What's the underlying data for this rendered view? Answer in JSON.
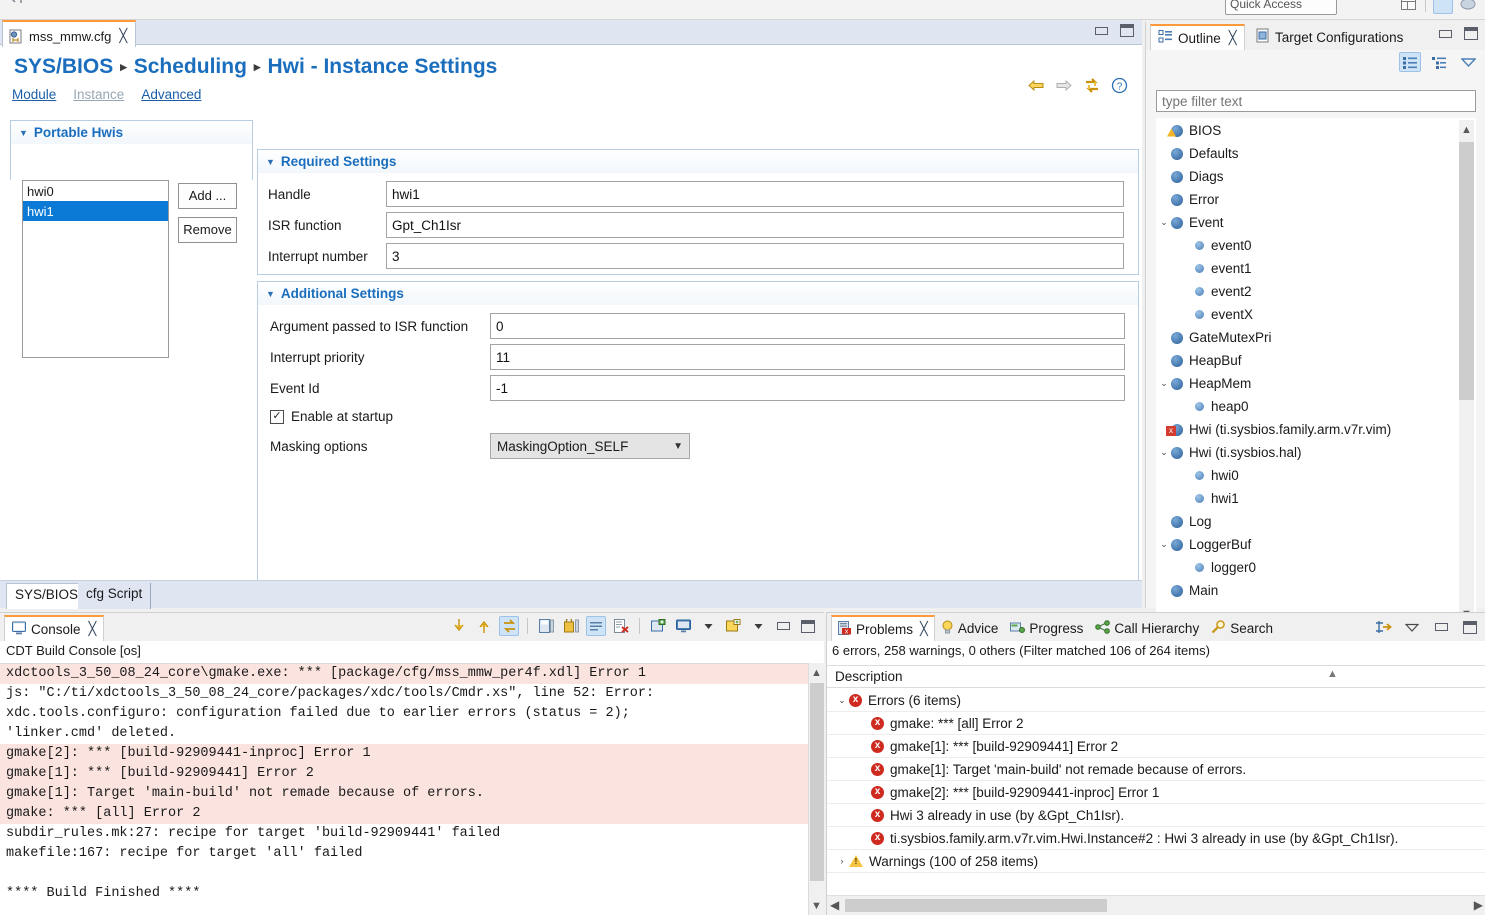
{
  "topbar": {
    "quick_access_label": "Quick Access",
    "perspective_icon": "perspective-switch-icon"
  },
  "editor": {
    "tab": {
      "label": "mss_mmw.cfg",
      "icon": "cfg-file-icon",
      "close": "╳"
    },
    "breadcrumb": {
      "root": "SYS/BIOS",
      "middle": "Scheduling",
      "leaf": "Hwi - Instance Settings",
      "separator": "▸"
    },
    "sublinks": [
      {
        "label": "Module",
        "enabled": true
      },
      {
        "label": "Instance",
        "enabled": false
      },
      {
        "label": "Advanced",
        "enabled": true
      }
    ],
    "header_icons": [
      "back-arrow-icon",
      "forward-arrow-icon",
      "refresh-icon",
      "help-icon"
    ],
    "bottom_tabs": [
      {
        "label": "SYS/BIOS",
        "selected": true
      },
      {
        "label": "cfg Script",
        "selected": false
      }
    ],
    "portable": {
      "title": "Portable Hwis",
      "items": [
        {
          "label": "hwi0",
          "selected": false
        },
        {
          "label": "hwi1",
          "selected": true
        }
      ],
      "add_label": "Add ...",
      "remove_label": "Remove"
    },
    "required": {
      "title": "Required Settings",
      "fields": [
        {
          "label": "Handle",
          "value": "hwi1"
        },
        {
          "label": "ISR function",
          "value": "Gpt_Ch1Isr"
        },
        {
          "label": "Interrupt number",
          "value": "3"
        }
      ]
    },
    "additional": {
      "title": "Additional Settings",
      "fields": [
        {
          "label": "Argument passed to ISR function",
          "value": "0"
        },
        {
          "label": "Interrupt priority",
          "value": "11"
        },
        {
          "label": "Event Id",
          "value": "-1"
        }
      ],
      "checkbox": {
        "label": "Enable at startup",
        "checked": true,
        "mark": "✓"
      },
      "masking": {
        "label": "Masking options",
        "value": "MaskingOption_SELF"
      }
    }
  },
  "outline": {
    "tabs": [
      {
        "label": "Outline",
        "icon": "outline-icon",
        "selected": true,
        "close": "╳"
      },
      {
        "label": "Target Configurations",
        "icon": "target-config-icon",
        "selected": false
      }
    ],
    "toolbar": [
      "flat-list-icon",
      "tree-list-icon",
      "view-menu-icon"
    ],
    "filter_placeholder": "type filter text",
    "tree": [
      {
        "label": "BIOS",
        "indent": 1,
        "twisty": "",
        "marker": "warn"
      },
      {
        "label": "Defaults",
        "indent": 1,
        "twisty": "",
        "marker": "module"
      },
      {
        "label": "Diags",
        "indent": 1,
        "twisty": "",
        "marker": "module"
      },
      {
        "label": "Error",
        "indent": 1,
        "twisty": "",
        "marker": "module"
      },
      {
        "label": "Event",
        "indent": 1,
        "twisty": "⌄",
        "marker": "module"
      },
      {
        "label": "event0",
        "indent": 2,
        "twisty": "",
        "marker": "instance"
      },
      {
        "label": "event1",
        "indent": 2,
        "twisty": "",
        "marker": "instance"
      },
      {
        "label": "event2",
        "indent": 2,
        "twisty": "",
        "marker": "instance"
      },
      {
        "label": "eventX",
        "indent": 2,
        "twisty": "",
        "marker": "instance"
      },
      {
        "label": "GateMutexPri",
        "indent": 1,
        "twisty": "",
        "marker": "module"
      },
      {
        "label": "HeapBuf",
        "indent": 1,
        "twisty": "",
        "marker": "module"
      },
      {
        "label": "HeapMem",
        "indent": 1,
        "twisty": "⌄",
        "marker": "module"
      },
      {
        "label": "heap0",
        "indent": 2,
        "twisty": "",
        "marker": "instance"
      },
      {
        "label": "Hwi (ti.sysbios.family.arm.v7r.vim)",
        "indent": 1,
        "twisty": "",
        "marker": "error"
      },
      {
        "label": "Hwi (ti.sysbios.hal)",
        "indent": 1,
        "twisty": "⌄",
        "marker": "module"
      },
      {
        "label": "hwi0",
        "indent": 2,
        "twisty": "",
        "marker": "instance"
      },
      {
        "label": "hwi1",
        "indent": 2,
        "twisty": "",
        "marker": "instance"
      },
      {
        "label": "Log",
        "indent": 1,
        "twisty": "",
        "marker": "module"
      },
      {
        "label": "LoggerBuf",
        "indent": 1,
        "twisty": "⌄",
        "marker": "module"
      },
      {
        "label": "logger0",
        "indent": 2,
        "twisty": "",
        "marker": "instance"
      },
      {
        "label": "Main",
        "indent": 1,
        "twisty": "",
        "marker": "module"
      }
    ]
  },
  "console": {
    "tab": {
      "label": "Console",
      "icon": "console-icon",
      "close": "╳"
    },
    "subtitle": "CDT Build Console [os]",
    "toolbar": [
      "scroll-down-icon",
      "scroll-up-icon",
      "scroll-lock-icon",
      "save-console-icon",
      "pin-console-icon",
      "word-wrap-icon",
      "clear-console-icon",
      "new-console-view-icon",
      "display-console-icon",
      "display-console-dropdown-icon",
      "open-console-icon",
      "open-console-dropdown-icon",
      "minimize-icon",
      "maximize-icon"
    ],
    "lines": [
      {
        "text": "xdctools_3_50_08_24_core\\gmake.exe: *** [package/cfg/mss_mmw_per4f.xdl] Error 1",
        "error": true
      },
      {
        "text": "js: \"C:/ti/xdctools_3_50_08_24_core/packages/xdc/tools/Cmdr.xs\", line 52: Error:",
        "error": false
      },
      {
        "text": "xdc.tools.configuro: configuration failed due to earlier errors (status = 2);",
        "error": false
      },
      {
        "text": "'linker.cmd' deleted.",
        "error": false
      },
      {
        "text": "gmake[2]: *** [build-92909441-inproc] Error 1",
        "error": true
      },
      {
        "text": "gmake[1]: *** [build-92909441] Error 2",
        "error": true
      },
      {
        "text": "gmake[1]: Target 'main-build' not remade because of errors.",
        "error": true
      },
      {
        "text": "gmake: *** [all] Error 2",
        "error": true
      },
      {
        "text": "subdir_rules.mk:27: recipe for target 'build-92909441' failed",
        "error": false
      },
      {
        "text": "makefile:167: recipe for target 'all' failed",
        "error": false
      },
      {
        "text": "",
        "error": false
      },
      {
        "text": "**** Build Finished ****",
        "error": false
      }
    ]
  },
  "problems": {
    "tabs": [
      {
        "label": "Problems",
        "icon": "problems-icon",
        "selected": true,
        "close": "╳"
      },
      {
        "label": "Advice",
        "icon": "lightbulb-icon",
        "selected": false
      },
      {
        "label": "Progress",
        "icon": "progress-icon",
        "selected": false
      },
      {
        "label": "Call Hierarchy",
        "icon": "call-hierarchy-icon",
        "selected": false
      },
      {
        "label": "Search",
        "icon": "search-icon",
        "selected": false
      }
    ],
    "toolbar": [
      "focus-on-selection-icon",
      "view-menu-icon",
      "minimize-icon",
      "maximize-icon"
    ],
    "summary": "6 errors, 258 warnings, 0 others (Filter matched 106 of 264 items)",
    "column_header": "Description",
    "rows": [
      {
        "label": "Errors (6 items)",
        "indent": 0,
        "twisty": "⌄",
        "icon": "error"
      },
      {
        "label": "gmake: *** [all] Error 2",
        "indent": 1,
        "twisty": "",
        "icon": "error"
      },
      {
        "label": "gmake[1]: *** [build-92909441] Error 2",
        "indent": 1,
        "twisty": "",
        "icon": "error"
      },
      {
        "label": "gmake[1]: Target 'main-build' not remade because of errors.",
        "indent": 1,
        "twisty": "",
        "icon": "error"
      },
      {
        "label": "gmake[2]: *** [build-92909441-inproc] Error 1",
        "indent": 1,
        "twisty": "",
        "icon": "error"
      },
      {
        "label": "Hwi 3 already in use (by &Gpt_Ch1Isr).",
        "indent": 1,
        "twisty": "",
        "icon": "error"
      },
      {
        "label": "ti.sysbios.family.arm.v7r.vim.Hwi.Instance#2 : Hwi 3 already in use (by &Gpt_Ch1Isr).",
        "indent": 1,
        "twisty": "",
        "icon": "error"
      },
      {
        "label": "Warnings (100 of 258 items)",
        "indent": 0,
        "twisty": "›",
        "icon": "warn"
      }
    ]
  },
  "colors": {
    "accent_blue": "#1a6ebd",
    "selection_blue": "#0b7ad6",
    "error_bg": "#fbe4e0",
    "error_red": "#cf2a20",
    "warning_yellow": "#f5c242",
    "tab_orange": "#ff9a3c"
  }
}
